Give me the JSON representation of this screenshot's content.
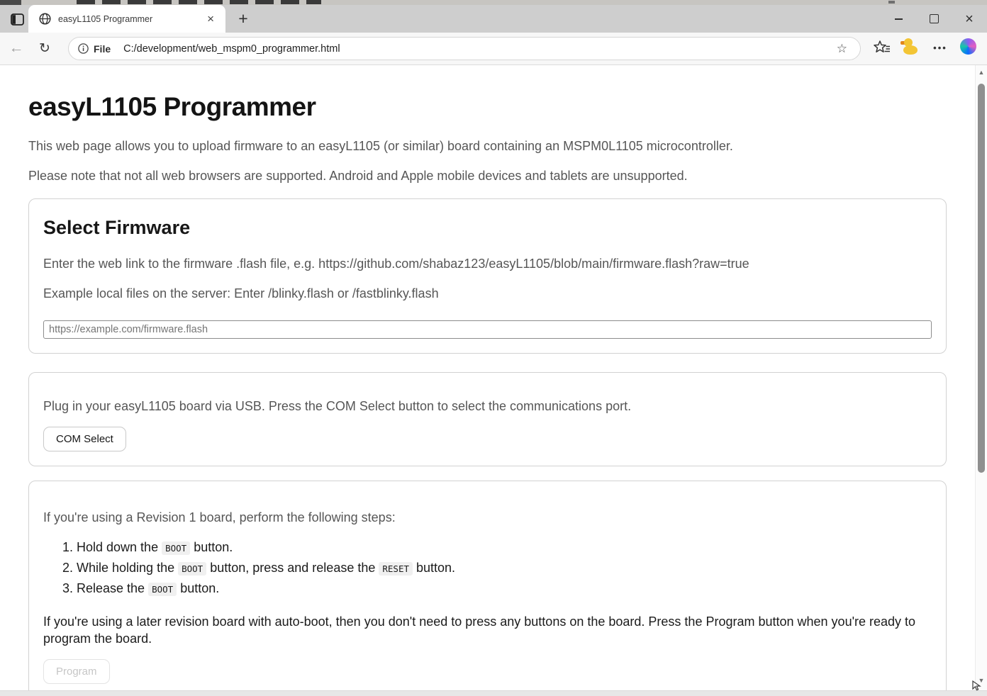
{
  "browser": {
    "tab_title": "easyL1105 Programmer",
    "address": {
      "scheme_label": "File",
      "url": "C:/development/web_mspm0_programmer.html"
    }
  },
  "icons": {
    "back": "←",
    "refresh": "↻",
    "star_outline": "☆",
    "menu_dots": "•••",
    "new_tab": "+",
    "tab_close": "×",
    "window_close": "×",
    "scroll_up": "▲",
    "scroll_down": "▼"
  },
  "colors": {
    "tab_strip": "#cecece",
    "toolbar": "#f7f7f7",
    "card_border": "#d2d2d2",
    "gray_text": "#565656",
    "chip_bg": "#f0f0f0",
    "duck_yellow": "#f3c535",
    "duck_beak": "#e2861c",
    "copilot_gradient": [
      "#0a6cff",
      "#16c8a6",
      "#8a5cf5",
      "#e45fc0"
    ]
  },
  "page": {
    "title": "easyL1105 Programmer",
    "intro1": "This web page allows you to upload firmware to an easyL1105 (or similar) board containing an MSPM0L1105 microcontroller.",
    "intro2": "Please note that not all web browsers are supported. Android and Apple mobile devices and tablets are unsupported.",
    "firmware_card": {
      "heading": "Select Firmware",
      "line1": "Enter the web link to the firmware .flash file, e.g. https://github.com/shabaz123/easyL1105/blob/main/firmware.flash?raw=true",
      "line2": "Example local files on the server: Enter /blinky.flash or /fastblinky.flash",
      "input_placeholder": "https://example.com/firmware.flash",
      "input_value": ""
    },
    "com_card": {
      "text": "Plug in your easyL1105 board via USB. Press the COM Select button to select the communications port.",
      "button": "COM Select"
    },
    "program_card": {
      "intro": "If you're using a Revision 1 board, perform the following steps:",
      "steps": [
        {
          "s1": "Hold down the ",
          "c1": "BOOT",
          "s2": " button."
        },
        {
          "s1": "While holding the ",
          "c1": "BOOT",
          "s2": " button, press and release the ",
          "c2": "RESET",
          "s3": " button."
        },
        {
          "s1": "Release the ",
          "c1": "BOOT",
          "s2": " button."
        }
      ],
      "later": "If you're using a later revision board with auto-boot, then you don't need to press any buttons on the board. Press the Program button when you're ready to program the board.",
      "button": "Program"
    }
  }
}
